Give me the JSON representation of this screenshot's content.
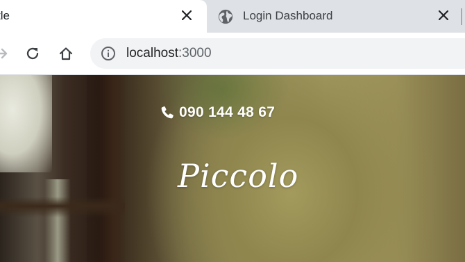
{
  "browser": {
    "tabs": [
      {
        "title": "tle",
        "active": true,
        "close_icon": "close-icon"
      },
      {
        "title": "Login Dashboard",
        "active": false,
        "favicon": "globe-icon",
        "close_icon": "close-icon"
      }
    ],
    "address_bar": {
      "host": "localhost",
      "port": ":3000",
      "icon": "info-icon"
    },
    "toolbar_icons": [
      "forward-icon",
      "reload-icon",
      "home-icon"
    ]
  },
  "page": {
    "phone": "090 144 48 67",
    "phone_icon": "phone-icon",
    "brand": "Piccolo"
  },
  "colors": {
    "tabstrip_bg": "#dee1e6",
    "omnibox_bg": "#f1f3f4",
    "text": "#202124",
    "hero_text": "#ffffff"
  }
}
